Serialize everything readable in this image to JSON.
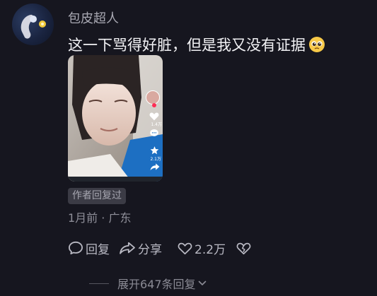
{
  "comment": {
    "username": "包皮超人",
    "text": "这一下骂得好脏，但是我又没有证据",
    "emoji": "pleading-face-emoji",
    "badge": "作者回复过",
    "time": "1月前",
    "location": "广东",
    "separator": " · "
  },
  "video_thumbnail": {
    "like_count": "1.4万",
    "star_count": "2.1万"
  },
  "actions": {
    "reply_label": "回复",
    "share_label": "分享",
    "like_count": "2.2万"
  },
  "expand": {
    "label": "展开647条回复"
  },
  "icons": [
    "avatar",
    "comment-bubble-icon",
    "share-icon",
    "heart-icon",
    "broken-heart-icon",
    "chevron-down-icon"
  ]
}
